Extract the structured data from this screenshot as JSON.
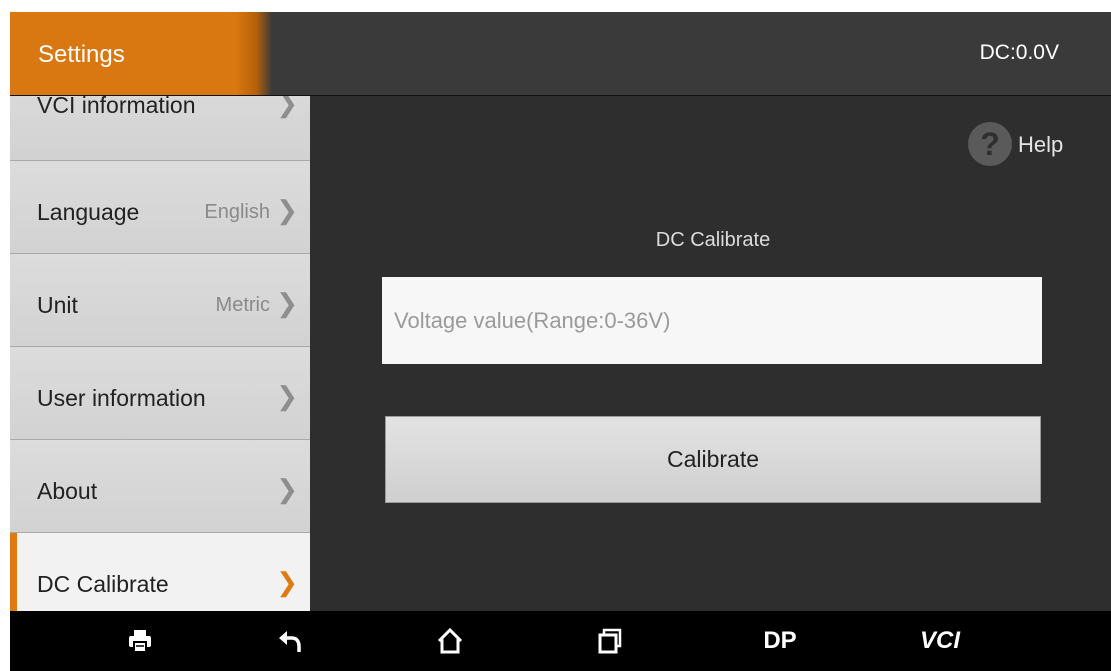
{
  "header": {
    "title": "Settings",
    "dc_status": "DC:0.0V"
  },
  "sidebar": {
    "items": [
      {
        "label": "VCI information",
        "value": ""
      },
      {
        "label": "Language",
        "value": "English"
      },
      {
        "label": "Unit",
        "value": "Metric"
      },
      {
        "label": "User information",
        "value": ""
      },
      {
        "label": "About",
        "value": ""
      },
      {
        "label": "DC Calibrate",
        "value": "",
        "active": true
      }
    ]
  },
  "main": {
    "help_label": "Help",
    "section_title": "DC Calibrate",
    "voltage_input": {
      "placeholder": "Voltage value(Range:0-36V)",
      "value": ""
    },
    "calibrate_label": "Calibrate"
  },
  "navbar": {
    "dp_label": "DP",
    "vci_label": "VCI"
  },
  "colors": {
    "accent": "#e07a10",
    "background": "#2e2e2e",
    "sidebar": "#d7d7d7"
  }
}
